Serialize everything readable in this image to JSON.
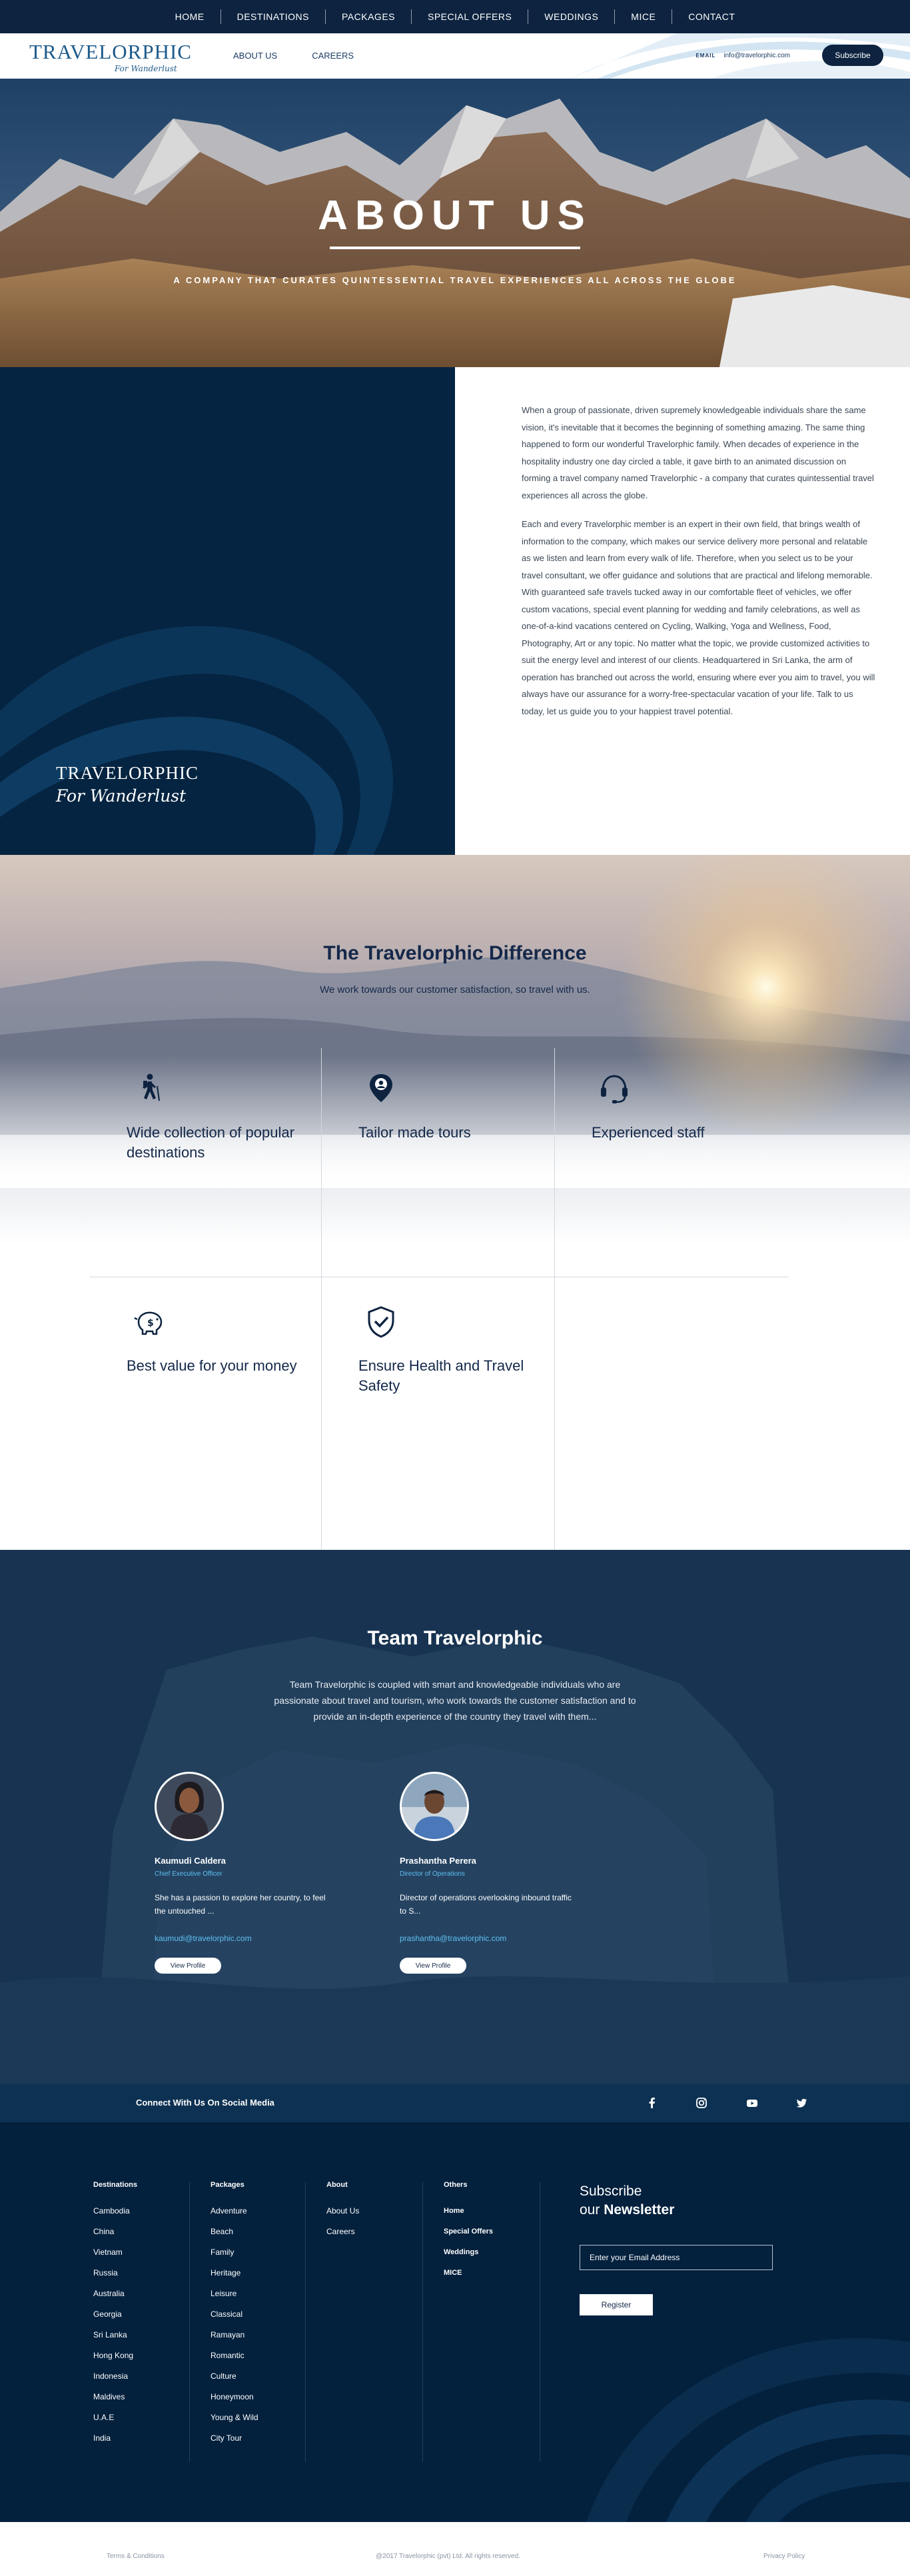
{
  "topnav": {
    "items": [
      "HOME",
      "DESTINATIONS",
      "PACKAGES",
      "SPECIAL OFFERS",
      "WEDDINGS",
      "MICE",
      "CONTACT"
    ]
  },
  "header": {
    "logo_main": "TRAVELORPHIC",
    "logo_sub": "For Wanderlust",
    "subnav": [
      "ABOUT US",
      "CAREERS"
    ],
    "email_label": "EMAIL",
    "email": "info@travelorphic.com",
    "subscribe": "Subscribe"
  },
  "hero": {
    "title": "ABOUT US",
    "subtitle": "A COMPANY THAT CURATES QUINTESSENTIAL TRAVEL EXPERIENCES ALL ACROSS THE GLOBE"
  },
  "about": {
    "brand_main": "TRAVELORPHIC",
    "brand_sub": "For Wanderlust",
    "paragraphs": [
      "When a group of passionate, driven supremely knowledgeable individuals share the same vision, it's inevitable that it becomes the beginning of something amazing. The same thing happened to form our wonderful Travelorphic family. When decades of experience in the hospitality industry one day circled a table, it gave birth to an animated discussion on forming a travel company named Travelorphic - a company that curates quintessential travel experiences all across the globe.",
      "Each and every Travelorphic member is an expert in their own field, that brings wealth of information to the company, which makes our service delivery more personal and relatable as we listen and learn from every walk of life. Therefore, when you select us to be your travel consultant, we offer guidance and solutions that are practical and lifelong memorable. With guaranteed safe travels tucked away in our comfortable fleet of vehicles, we offer custom vacations, special event planning for wedding and family celebrations, as well as one-of-a-kind vacations centered on Cycling, Walking, Yoga and Wellness, Food, Photography, Art or any topic. No matter what the topic, we provide customized activities to suit the energy level and interest of our clients. Headquartered in Sri Lanka, the arm of operation has branched out across the world, ensuring where ever you aim to travel, you will always have our assurance for a worry-free-spectacular vacation of your life. Talk to us today, let us guide you to your happiest travel potential."
    ]
  },
  "difference": {
    "title_light": "The Travelorphic ",
    "title_bold": "Difference",
    "subtitle": "We work towards our customer satisfaction, so travel with us.",
    "features": [
      {
        "title": "Wide collection of popular destinations",
        "icon": "hiker-icon"
      },
      {
        "title": "Tailor made tours",
        "icon": "map-pin-icon"
      },
      {
        "title": "Experienced staff",
        "icon": "headset-icon"
      },
      {
        "title": "Best value for your money",
        "icon": "piggy-bank-icon"
      },
      {
        "title": "Ensure Health and Travel Safety",
        "icon": "shield-check-icon"
      }
    ]
  },
  "team": {
    "title_light": "Team ",
    "title_bold": "Travelorphic",
    "description": "Team Travelorphic is coupled with smart and knowledgeable individuals who are passionate about travel and tourism, who work towards the customer satisfaction and to provide an in-depth experience of the country they travel with them...",
    "members": [
      {
        "name": "Kaumudi Caldera",
        "role": "Chief Executive Officer",
        "desc": "She has a passion to explore her country, to feel the untouched ...",
        "email": "kaumudi@travelorphic.com",
        "button": "View Profile"
      },
      {
        "name": "Prashantha Perera",
        "role": "Director of Operations",
        "desc": "Director of operations overlooking inbound traffic to S...",
        "email": "prashantha@travelorphic.com",
        "button": "View Profile"
      }
    ]
  },
  "social": {
    "label": "Connect With Us On Social Media",
    "icons": [
      "facebook-icon",
      "instagram-icon",
      "youtube-icon",
      "twitter-icon"
    ]
  },
  "footer": {
    "destinations": {
      "heading": "Destinations",
      "items": [
        "Cambodia",
        "China",
        "Vietnam",
        "Russia",
        "Australia",
        "Georgia",
        "Sri Lanka",
        "Hong Kong",
        "Indonesia",
        "Maldives",
        "U.A.E",
        "India"
      ]
    },
    "packages": {
      "heading": "Packages",
      "items": [
        "Adventure",
        "Beach",
        "Family",
        "Heritage",
        "Leisure",
        "Classical",
        "Ramayan",
        "Romantic",
        "Culture",
        "Honeymoon",
        "Young & Wild",
        "City Tour"
      ]
    },
    "about": {
      "heading": "About",
      "items": [
        "About Us",
        "Careers"
      ]
    },
    "others": {
      "heading": "Others",
      "items": [
        "Home",
        "Special Offers",
        "Weddings",
        "MICE"
      ]
    },
    "newsletter": {
      "line1": "Subscribe",
      "line2_light": "our ",
      "line2_bold": "Newsletter",
      "placeholder": "Enter your Email Address",
      "button": "Register"
    }
  },
  "bottom": {
    "terms": "Terms & Conditions",
    "copyright": "@2017 Travelorphic (pvt) Ltd. All rights reserved.",
    "privacy": "Privacy Policy"
  },
  "colors": {
    "navy": "#0d2340",
    "deep_navy": "#042441",
    "footer_navy": "#03203d",
    "accent_blue": "#5fc0f2",
    "brand_blue": "#1d5a8a"
  }
}
